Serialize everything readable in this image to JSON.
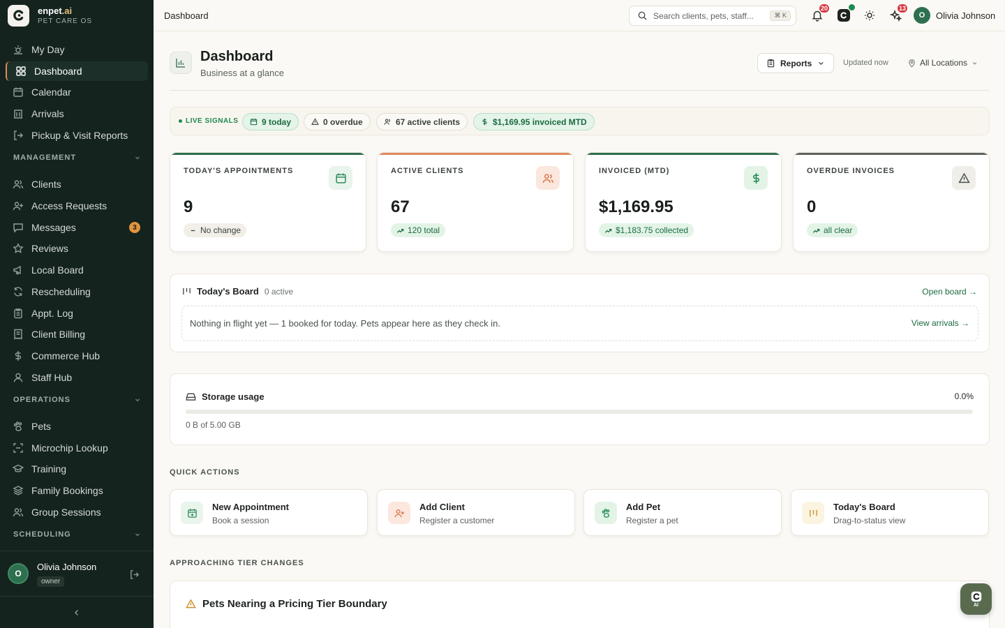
{
  "brand": {
    "name": "enpet",
    "name_suffix": ".ai",
    "subtitle": "PET CARE OS"
  },
  "sidebar": {
    "top_items": [
      {
        "label": "My Day",
        "icon": "sun-icon"
      },
      {
        "label": "Dashboard",
        "icon": "layout-grid-icon",
        "active": true
      },
      {
        "label": "Calendar",
        "icon": "calendar-icon"
      },
      {
        "label": "Arrivals",
        "icon": "building-icon"
      },
      {
        "label": "Pickup & Visit Reports",
        "icon": "exit-icon"
      }
    ],
    "sections": [
      {
        "title": "MANAGEMENT",
        "items": [
          {
            "label": "Clients",
            "icon": "users-icon"
          },
          {
            "label": "Access Requests",
            "icon": "user-plus-icon"
          },
          {
            "label": "Messages",
            "icon": "message-icon",
            "badge": "3"
          },
          {
            "label": "Reviews",
            "icon": "star-icon"
          },
          {
            "label": "Local Board",
            "icon": "megaphone-icon"
          },
          {
            "label": "Rescheduling",
            "icon": "refresh-icon"
          },
          {
            "label": "Appt. Log",
            "icon": "clipboard-icon"
          },
          {
            "label": "Client Billing",
            "icon": "receipt-icon"
          },
          {
            "label": "Commerce Hub",
            "icon": "dollar-icon"
          },
          {
            "label": "Staff Hub",
            "icon": "user-icon"
          }
        ]
      },
      {
        "title": "OPERATIONS",
        "items": [
          {
            "label": "Pets",
            "icon": "paw-icon"
          },
          {
            "label": "Microchip Lookup",
            "icon": "scan-icon"
          },
          {
            "label": "Training",
            "icon": "graduation-icon"
          },
          {
            "label": "Family Bookings",
            "icon": "layers-icon"
          },
          {
            "label": "Group Sessions",
            "icon": "group-icon"
          }
        ]
      },
      {
        "title": "SCHEDULING",
        "items": []
      }
    ],
    "user": {
      "initial": "O",
      "name": "Olivia Johnson",
      "role": "owner"
    }
  },
  "topbar": {
    "title": "Dashboard",
    "search_placeholder": "Search clients, pets, staff...",
    "search_kbd": "⌘ K",
    "notifications_count": "20",
    "activity_count": "13",
    "user_initial": "O",
    "user_name": "Olivia Johnson"
  },
  "header": {
    "title": "Dashboard",
    "subtitle": "Business at a glance",
    "reports_label": "Reports",
    "updated": "Updated now",
    "location": "All Locations"
  },
  "signals": {
    "label": "LIVE SIGNALS",
    "chips": [
      {
        "label": "9 today",
        "style": "green",
        "icon": "calendar-icon"
      },
      {
        "label": "0 overdue",
        "style": "plain",
        "icon": "alert-icon"
      },
      {
        "label": "67 active clients",
        "style": "plain",
        "icon": "users-icon"
      },
      {
        "label": "$1,169.95 invoiced MTD",
        "style": "green",
        "icon": "dollar-icon"
      }
    ]
  },
  "kpis": [
    {
      "label": "TODAY'S APPOINTMENTS",
      "value": "9",
      "delta": "No change",
      "delta_style": "neutral",
      "accent": "#2e6f4f",
      "icon_bg": "#e8f4ec",
      "icon_color": "#2e8a5a",
      "icon": "calendar-icon"
    },
    {
      "label": "ACTIVE CLIENTS",
      "value": "67",
      "delta": "120 total",
      "delta_style": "up",
      "accent": "#e0895a",
      "icon_bg": "#fbe7dd",
      "icon_color": "#d6764a",
      "icon": "users-icon"
    },
    {
      "label": "INVOICED (MTD)",
      "value": "$1,169.95",
      "delta": "$1,183.75 collected",
      "delta_style": "up",
      "accent": "#2e6f4f",
      "icon_bg": "#e3f4e7",
      "icon_color": "#1f8a52",
      "icon": "dollar-icon"
    },
    {
      "label": "OVERDUE INVOICES",
      "value": "0",
      "delta": "all clear",
      "delta_style": "up",
      "accent": "#5d645f",
      "icon_bg": "#f0eee9",
      "icon_color": "#4a514d",
      "icon": "alert-icon"
    }
  ],
  "board": {
    "title": "Today's Board",
    "count": "0 active",
    "open_label": "Open board →",
    "empty_text": "Nothing in flight yet — 1 booked for today. Pets appear here as they check in.",
    "arrivals_label": "View arrivals →"
  },
  "storage": {
    "title": "Storage usage",
    "percent_label": "0.0%",
    "used_fraction": 0.0,
    "detail": "0 B of 5.00 GB"
  },
  "quick_actions": {
    "label": "QUICK ACTIONS",
    "items": [
      {
        "title": "New Appointment",
        "subtitle": "Book a session",
        "icon": "calendar-plus-icon",
        "icon_bg": "#e8f4ec",
        "icon_color": "#2e8a5a"
      },
      {
        "title": "Add Client",
        "subtitle": "Register a customer",
        "icon": "user-plus-icon",
        "icon_bg": "#fbe7dd",
        "icon_color": "#d6764a"
      },
      {
        "title": "Add Pet",
        "subtitle": "Register a pet",
        "icon": "paw-icon",
        "icon_bg": "#e3f4e7",
        "icon_color": "#1f8a52"
      },
      {
        "title": "Today's Board",
        "subtitle": "Drag-to-status view",
        "icon": "columns-icon",
        "icon_bg": "#fbf4e0",
        "icon_color": "#c9972e"
      }
    ]
  },
  "tier": {
    "label": "APPROACHING TIER CHANGES",
    "title": "Pets Nearing a Pricing Tier Boundary"
  },
  "fab": {
    "label": "AI"
  }
}
